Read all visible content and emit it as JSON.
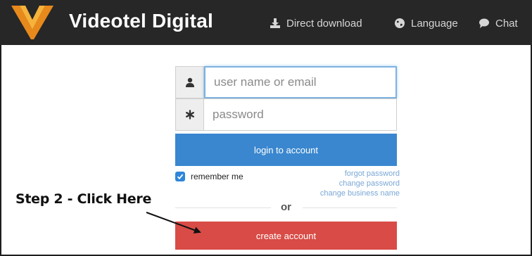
{
  "header": {
    "brand": "Videotel Digital",
    "nav": {
      "download": {
        "label": "Direct download",
        "icon": "download-icon"
      },
      "language": {
        "label": "Language",
        "icon": "globe-icon"
      },
      "chat": {
        "label": "Chat",
        "icon": "chat-bubble-icon"
      }
    },
    "logo_colors": [
      "#f6a21c",
      "#e4661e"
    ]
  },
  "login_form": {
    "username": {
      "placeholder": "user name or email",
      "value": "",
      "icon": "user-icon"
    },
    "password": {
      "placeholder": "password",
      "value": "",
      "icon": "asterisk-icon"
    },
    "login_label": "login to account",
    "remember_label": "remember me",
    "remember_checked": true,
    "links": {
      "forgot": "forgot password",
      "change_password": "change password",
      "change_business": "change business name"
    },
    "or_text": "or",
    "create_label": "create account"
  },
  "annotation": {
    "step_text": "Step 2 - Click Here"
  },
  "colors": {
    "header_bg": "#272727",
    "login_button": "#3a87cf",
    "create_button": "#d84b46",
    "link": "#7aa7d6"
  }
}
